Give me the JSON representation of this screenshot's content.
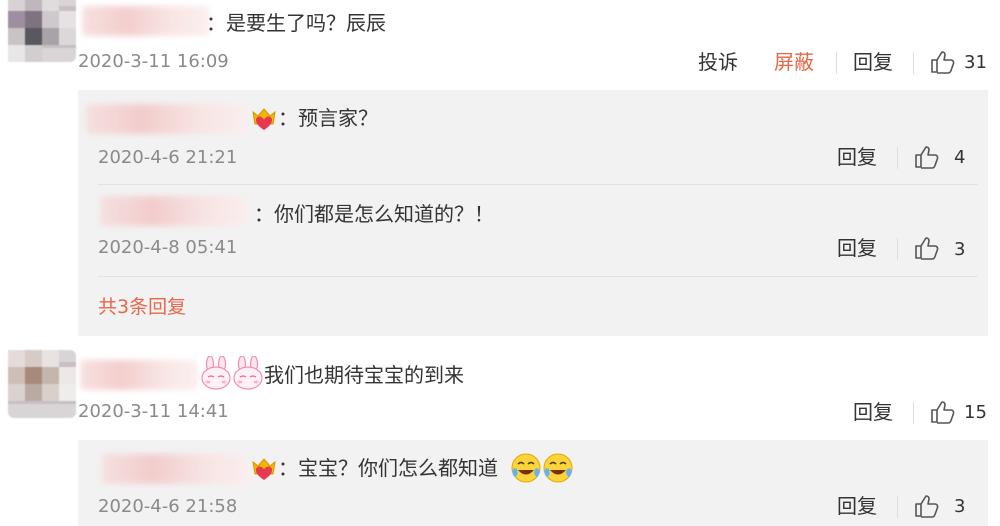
{
  "comments": [
    {
      "text": "：是要生了吗？辰辰",
      "time": "2020-3-11 16:09",
      "report_label": "投诉",
      "block_label": "屏蔽",
      "reply_label": "回复",
      "likes": "31",
      "replies": [
        {
          "text": "：预言家？",
          "time": "2020-4-6 21:21",
          "reply_label": "回复",
          "likes": "4"
        },
        {
          "text": "：你们都是怎么知道的？！",
          "time": "2020-4-8 05:41",
          "reply_label": "回复",
          "likes": "3"
        }
      ],
      "more_label": "共3条回复"
    },
    {
      "text": "我们也期待宝宝的到来",
      "time": "2020-3-11 14:41",
      "reply_label": "回复",
      "likes": "15",
      "replies": [
        {
          "text": "：宝宝？你们怎么都知道",
          "time": "2020-4-6 21:58",
          "reply_label": "回复",
          "likes": "3"
        }
      ]
    }
  ],
  "colors": {
    "accent": "#e8674a",
    "reply_bg": "#f2f2f2",
    "text": "#333333",
    "muted": "#8a8a8a"
  },
  "icons": [
    "thumbs-up-icon",
    "crown-heart-badge-icon",
    "bunny-emoji-icon",
    "laughing-tears-emoji-icon"
  ]
}
